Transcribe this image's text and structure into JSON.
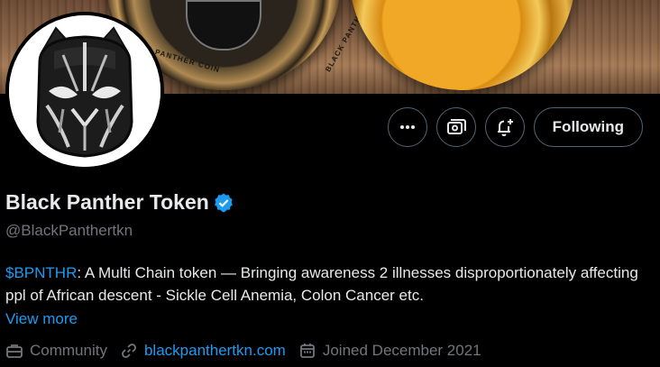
{
  "banner": {
    "coin_text_left": "BLACK PANTHER COIN",
    "coin_text_right": "BLACK PANTHER COIN"
  },
  "actions": {
    "more_icon": "more-horizontal-icon",
    "subscribe_icon": "subscribe-icon",
    "notify_icon": "bell-plus-icon",
    "follow_label": "Following"
  },
  "profile": {
    "display_name": "Black Panther Token",
    "verified_color": "#1d9bf0",
    "handle": "@BlackPanthertkn",
    "bio_cashtag": "$BPNTHR",
    "bio_text": ": A Multi Chain token — Bringing awareness 2 illnesses disproportionately affecting ppl of African descent - Sickle Cell Anemia, Colon Cancer etc.",
    "view_more": "View more"
  },
  "meta": {
    "category": "Community",
    "website": "blackpanthertkn.com",
    "joined": "Joined December 2021"
  },
  "colors": {
    "accent": "#1d9bf0",
    "muted": "#71767b",
    "border": "#536471"
  }
}
